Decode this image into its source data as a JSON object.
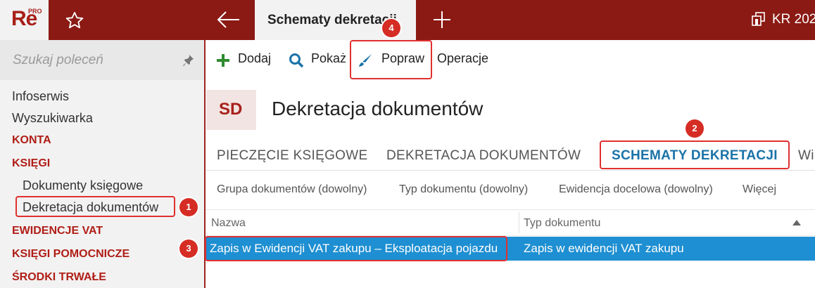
{
  "app": {
    "logo_text": "Re",
    "logo_badge": "PRO"
  },
  "topbar": {
    "active_tab": "Schematy dekretacji",
    "company": "KR 202"
  },
  "sidebar": {
    "search_placeholder": "Szukaj poleceń",
    "items": [
      {
        "label": "Infoserwis",
        "kind": "plain"
      },
      {
        "label": "Wyszukiwarka",
        "kind": "plain"
      },
      {
        "label": "KONTA",
        "kind": "section"
      },
      {
        "label": "KSIĘGI",
        "kind": "section"
      },
      {
        "label": "Dokumenty księgowe",
        "kind": "sub"
      },
      {
        "label": "Dekretacja dokumentów",
        "kind": "sub"
      },
      {
        "label": "EWIDENCJE VAT",
        "kind": "section"
      },
      {
        "label": "KSIĘGI POMOCNICZE",
        "kind": "section"
      },
      {
        "label": "ŚRODKI TRWAŁE",
        "kind": "section"
      }
    ]
  },
  "toolbar": {
    "add": "Dodaj",
    "show": "Pokaż",
    "edit": "Popraw",
    "operations": "Operacje"
  },
  "page": {
    "badge": "SD",
    "title": "Dekretacja dokumentów"
  },
  "tabs": [
    {
      "label": "PIECZĘCIE KSIĘGOWE",
      "active": false
    },
    {
      "label": "DEKRETACJA DOKUMENTÓW",
      "active": false
    },
    {
      "label": "SCHEMATY DEKRETACJI",
      "active": true
    },
    {
      "label": "Wi",
      "active": false
    }
  ],
  "filters": [
    "Grupa dokumentów (dowolny)",
    "Typ dokumentu (dowolny)",
    "Ewidencja docelowa (dowolny)",
    "Więcej"
  ],
  "grid": {
    "columns": [
      "Nazwa",
      "Typ dokumentu"
    ],
    "rows": [
      {
        "name": "Zapis w Ewidencji VAT zakupu – Eksploatacja pojazdu",
        "type": "Zapis w ewidencji VAT zakupu"
      }
    ]
  },
  "callouts": [
    "1",
    "2",
    "3",
    "4"
  ],
  "colors": {
    "brand_red": "#8b1a14",
    "section_red": "#b01e17",
    "tab_active_blue": "#1a73a8",
    "row_selected_blue": "#1e8fd2",
    "callout_red": "#d52c24",
    "add_icon_green": "#2e8b2e"
  }
}
